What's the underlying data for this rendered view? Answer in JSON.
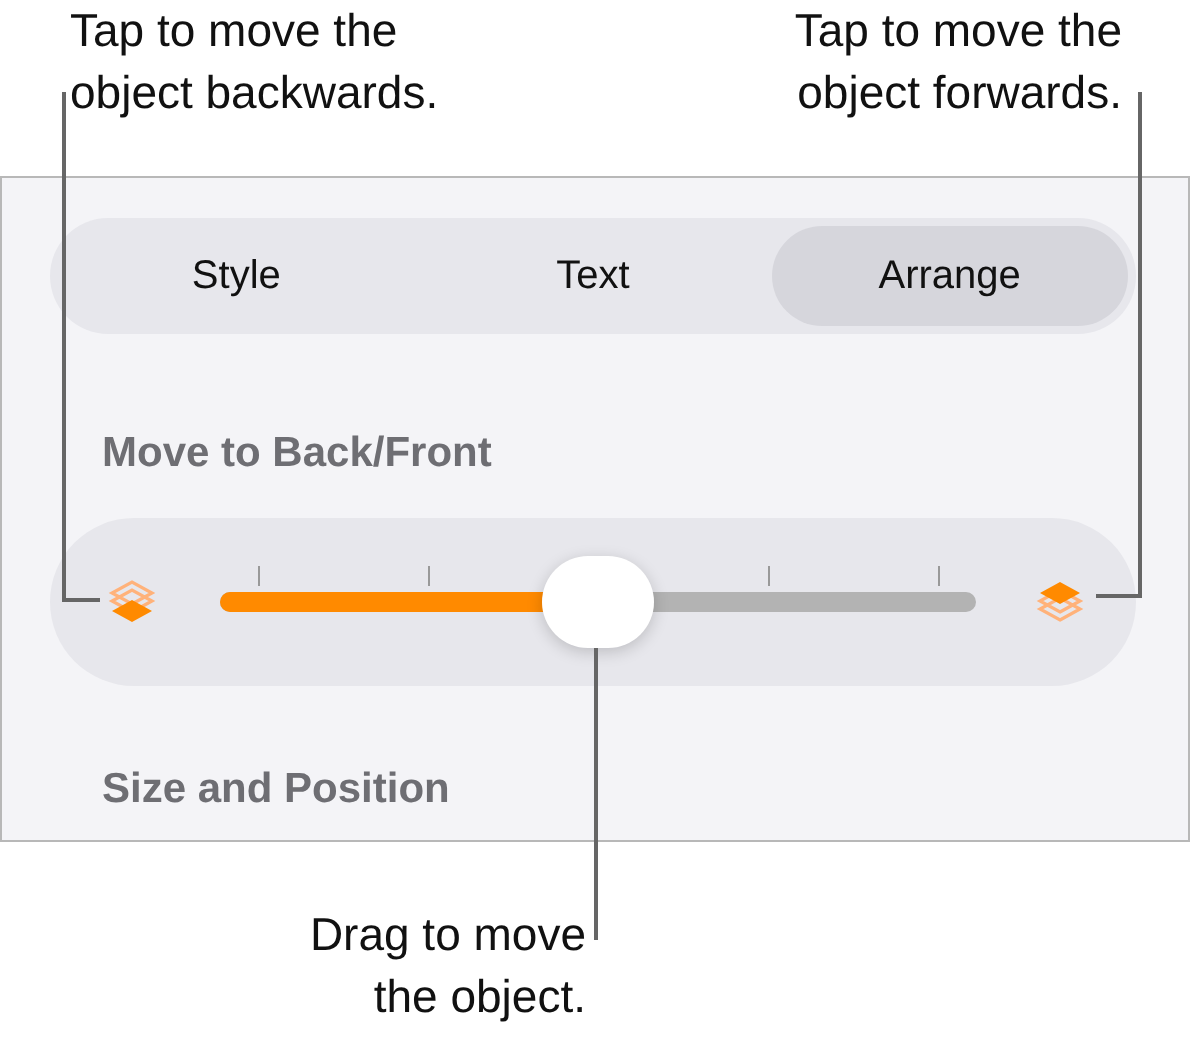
{
  "callouts": [
    {
      "text": "Tap to move the\nobject backwards."
    },
    {
      "text": "Tap to move the\nobject forwards."
    },
    {
      "text": "Drag to move\nthe object."
    }
  ],
  "tabs": [
    {
      "label": "Style",
      "selected": false
    },
    {
      "label": "Text",
      "selected": false
    },
    {
      "label": "Arrange",
      "selected": true
    }
  ],
  "sections": [
    {
      "label": "Move to Back/Front"
    },
    {
      "label": "Size and Position"
    }
  ],
  "slider": {
    "level": 0.5
  }
}
